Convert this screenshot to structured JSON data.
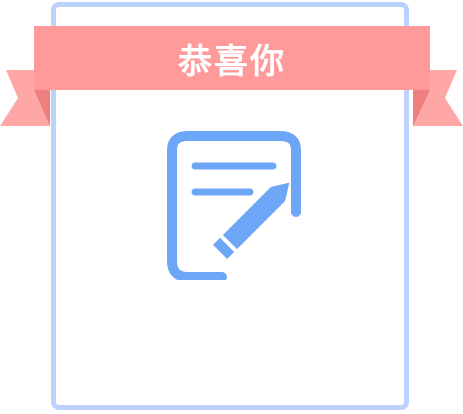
{
  "ribbon": {
    "title": "恭喜你"
  },
  "icons": {
    "document": "document-edit-icon"
  },
  "colors": {
    "card_border": "#bcd2fb",
    "ribbon_main": "#ff9a9a",
    "ribbon_tail": "#ffa6a6",
    "ribbon_fold": "#ef7f7f",
    "icon": "#6ea6f7"
  }
}
